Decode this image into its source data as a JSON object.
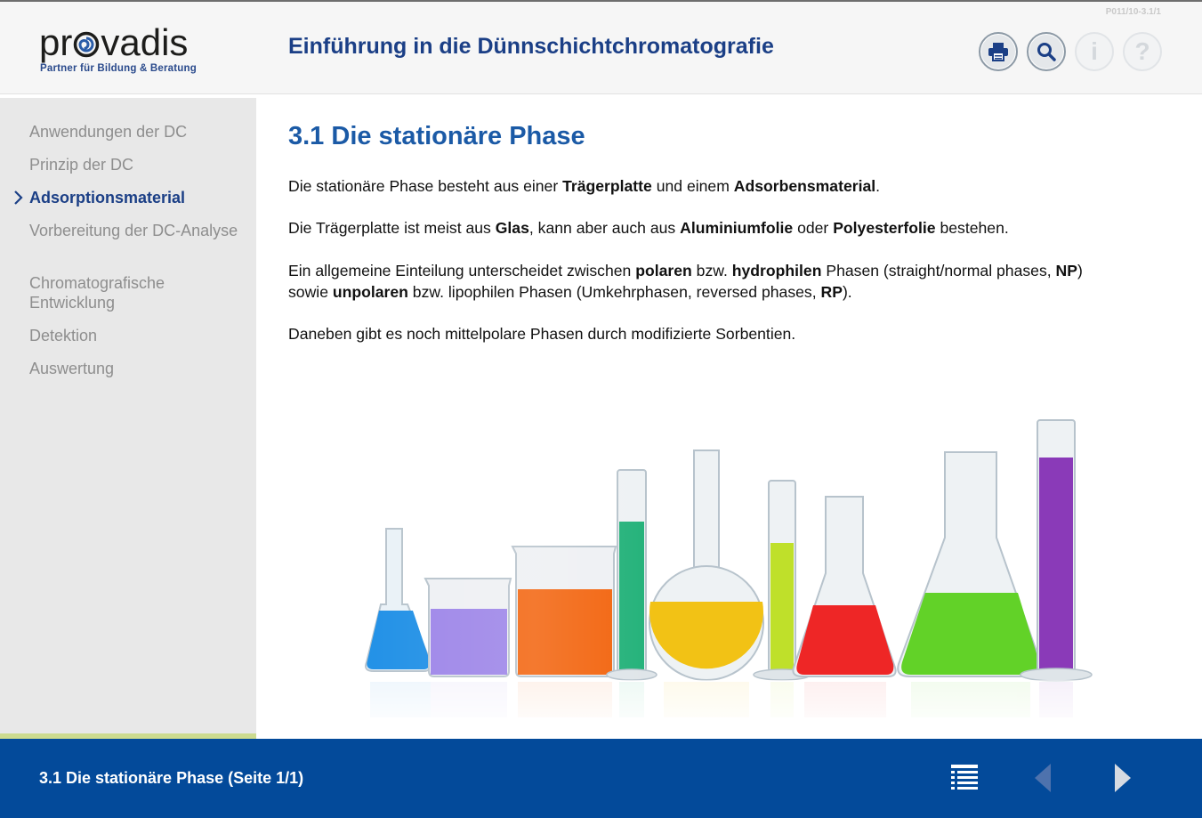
{
  "header": {
    "logo_word_pre": "pr",
    "logo_word_post": "vadis",
    "logo_tagline": "Partner für Bildung & Beratung",
    "course_title": "Einführung in die Dünnschichtchromatografie",
    "page_code": "P011/10-3.1/1",
    "tools": [
      {
        "name": "print",
        "icon": "printer-icon",
        "enabled": true
      },
      {
        "name": "search",
        "icon": "magnifier-icon",
        "enabled": true
      },
      {
        "name": "info",
        "icon": "info-icon",
        "label": "i",
        "enabled": false
      },
      {
        "name": "help",
        "icon": "question-icon",
        "label": "?",
        "enabled": false
      }
    ]
  },
  "sidebar": {
    "items": [
      {
        "label": "Anwendungen der DC",
        "current": false
      },
      {
        "label": "Prinzip der DC",
        "current": false
      },
      {
        "label": "Adsorptionsmaterial",
        "current": true
      },
      {
        "label": "Vorbereitung der DC-Analyse",
        "current": false
      },
      {
        "label": "Chromatografische Entwicklung",
        "current": false
      },
      {
        "label": "Detektion",
        "current": false
      },
      {
        "label": "Auswertung",
        "current": false
      }
    ]
  },
  "main": {
    "title": "3.1 Die stationäre Phase",
    "p1": {
      "t1": "Die stationäre Phase besteht aus einer ",
      "b1": "Trägerplatte",
      "t2": " und einem ",
      "b2": "Adsorbensmaterial",
      "t3": "."
    },
    "p2": {
      "t1": "Die Trägerplatte ist meist aus ",
      "b1": "Glas",
      "t2": ", kann aber auch aus ",
      "b2": "Aluminiumfolie",
      "t3": " oder ",
      "b3": "Polyesterfolie",
      "t4": " bestehen."
    },
    "p3": {
      "t1": "Ein allgemeine Einteilung unterscheidet zwischen ",
      "b1": "polaren",
      "t2": " bzw. ",
      "b2": "hydrophilen",
      "t3": " Phasen (straight/normal phases, ",
      "b3": "NP",
      "t4": ") sowie ",
      "b4": "unpolaren",
      "t5": " bzw. lipophilen Phasen (Umkehrphasen, reversed phases, ",
      "b5": "RP",
      "t6": ")."
    },
    "p4": "Daneben gibt es noch mittelpolare Phasen durch modifizierte Sorbentien.",
    "illustration": {
      "subject": "laboratory-glassware",
      "liquid_colors": [
        "#1e8fe6",
        "#9c84e8",
        "#f2640e",
        "#24b27a",
        "#f2c215",
        "#bfe02a",
        "#ee2626",
        "#62d228",
        "#8a3ab8"
      ]
    }
  },
  "footer": {
    "page_label": "3.1 Die stationäre Phase (Seite 1/1)",
    "buttons": [
      {
        "name": "toc",
        "icon": "list-icon",
        "enabled": true
      },
      {
        "name": "previous",
        "icon": "arrow-left-icon",
        "enabled": false
      },
      {
        "name": "next",
        "icon": "arrow-right-icon",
        "enabled": true
      }
    ]
  },
  "colors": {
    "brand_blue": "#034a9a",
    "title_blue": "#1b5aa6",
    "nav_active": "#1b3f86",
    "nav_inactive": "#8e8e8e",
    "progress_green": "#ccdb8f"
  }
}
